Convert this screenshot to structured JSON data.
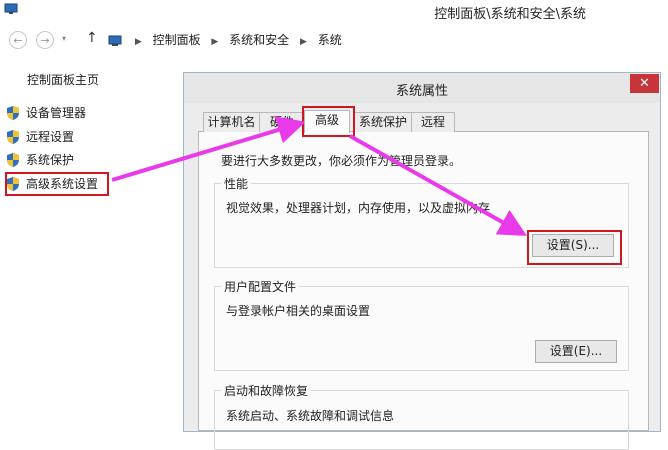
{
  "window": {
    "title": "控制面板\\系统和安全\\系统"
  },
  "address_bar": {
    "back_icon": "back-arrow-icon",
    "forward_icon": "forward-arrow-icon",
    "up_icon": "up-arrow-icon",
    "path": [
      "控制面板",
      "系统和安全",
      "系统"
    ]
  },
  "left_panel": {
    "title": "控制面板主页",
    "items": [
      {
        "label": "设备管理器",
        "icon": "shield-icon"
      },
      {
        "label": "远程设置",
        "icon": "shield-icon"
      },
      {
        "label": "系统保护",
        "icon": "shield-icon"
      },
      {
        "label": "高级系统设置",
        "icon": "shield-icon"
      }
    ]
  },
  "dialog": {
    "title": "系统属性",
    "close_label": "✕",
    "tabs": [
      "计算机名",
      "硬件",
      "高级",
      "系统保护",
      "远程"
    ],
    "active_tab": "高级",
    "admin_note": "要进行大多数更改，你必须作为管理员登录。",
    "performance": {
      "label": "性能",
      "description": "视觉效果，处理器计划，内存使用，以及虚拟内存",
      "button": "设置(S)..."
    },
    "user_profiles": {
      "label": "用户配置文件",
      "description": "与登录帐户相关的桌面设置",
      "button": "设置(E)..."
    },
    "startup_recovery": {
      "label": "启动和故障恢复",
      "description": "系统启动、系统故障和调试信息"
    }
  },
  "colors": {
    "annotation_red": "#d0161f",
    "arrow_magenta": "#e83ae8",
    "close_red": "#c7343a"
  }
}
